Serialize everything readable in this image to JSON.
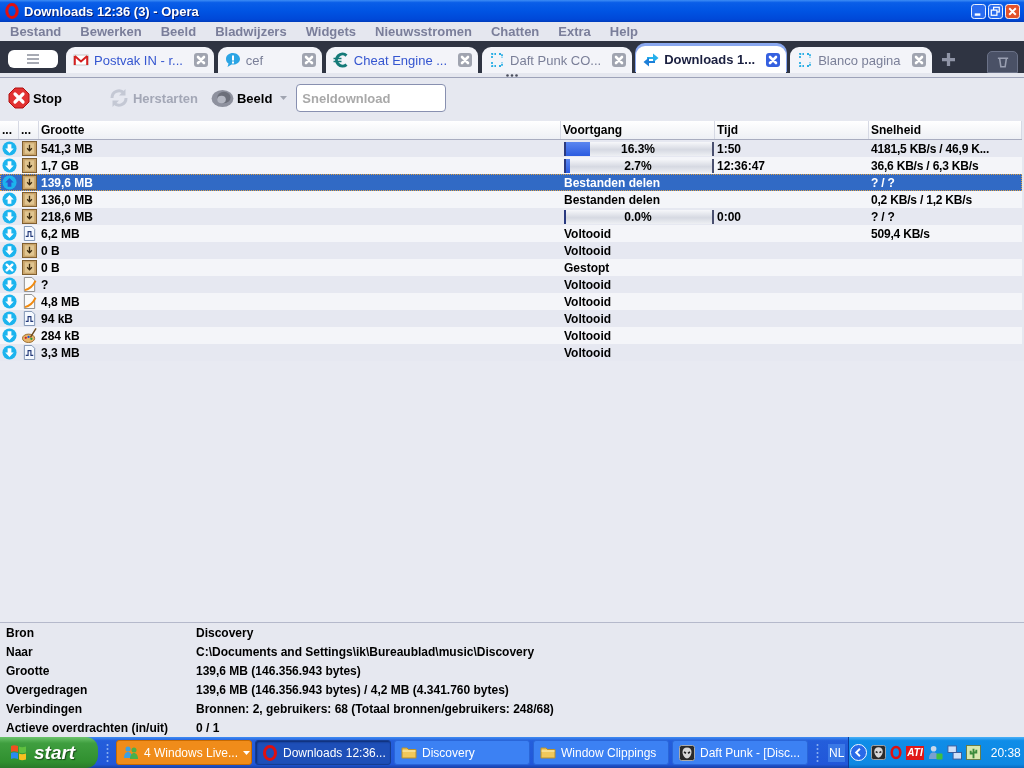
{
  "window": {
    "title": "Downloads 12:36 (3) - Opera"
  },
  "menu": [
    "Bestand",
    "Bewerken",
    "Beeld",
    "Bladwijzers",
    "Widgets",
    "Nieuwsstromen",
    "Chatten",
    "Extra",
    "Help"
  ],
  "tabs": [
    {
      "label": "Postvak IN - r...",
      "kind": "mail",
      "selected": false,
      "highlighted": true
    },
    {
      "label": "cef",
      "kind": "chat",
      "selected": false,
      "highlighted": false
    },
    {
      "label": "Cheat Engine ...",
      "kind": "app",
      "selected": false,
      "highlighted": true
    },
    {
      "label": "Daft Punk CO...",
      "kind": "page",
      "selected": false,
      "highlighted": false
    },
    {
      "label": "Downloads 1...",
      "kind": "transfers",
      "selected": true,
      "highlighted": false
    },
    {
      "label": "Blanco pagina",
      "kind": "page",
      "selected": false,
      "highlighted": false
    }
  ],
  "toolbar": {
    "buttons": [
      {
        "label": "Stop",
        "kind": "stop",
        "disabled": false
      },
      {
        "label": "Herstarten",
        "kind": "restart",
        "disabled": true
      },
      {
        "label": "Beeld",
        "kind": "view",
        "disabled": false
      }
    ],
    "search": {
      "placeholder": "Sneldownload"
    }
  },
  "table": {
    "columns": [
      "...",
      "...",
      "Grootte",
      "Voortgang",
      "Tijd",
      "Snelheid"
    ],
    "rows": [
      {
        "state": {
          "kind": "download"
        },
        "type": {
          "kind": "archive"
        },
        "size": "541,3 MB",
        "progress": {
          "kind": "bar",
          "level": 0.163,
          "label": "16.3%"
        },
        "time": "1:50",
        "speed": "4181,5 KB/s / 46,9 K...",
        "selected": false
      },
      {
        "state": {
          "kind": "download"
        },
        "type": {
          "kind": "archive"
        },
        "size": "1,7 GB",
        "progress": {
          "kind": "bar",
          "level": 0.027,
          "label": "2.7%"
        },
        "time": "12:36:47",
        "speed": "36,6 KB/s / 6,3 KB/s",
        "selected": false
      },
      {
        "state": {
          "kind": "upload"
        },
        "type": {
          "kind": "archive"
        },
        "size": "139,6 MB",
        "progress": {
          "kind": "text",
          "label": "Bestanden delen"
        },
        "speed": "? / ?",
        "selected": true
      },
      {
        "state": {
          "kind": "upload"
        },
        "type": {
          "kind": "archive"
        },
        "size": "136,0 MB",
        "progress": {
          "kind": "text",
          "label": "Bestanden delen"
        },
        "speed": "0,2 KB/s / 1,2 KB/s",
        "selected": false
      },
      {
        "state": {
          "kind": "download"
        },
        "type": {
          "kind": "archive"
        },
        "size": "218,6 MB",
        "progress": {
          "kind": "bar",
          "level": 0.0,
          "label": "0.0%"
        },
        "time": "0:00",
        "speed": "? / ?",
        "selected": false
      },
      {
        "state": {
          "kind": "download"
        },
        "type": {
          "kind": "audio"
        },
        "size": "6,2 MB",
        "progress": {
          "kind": "text",
          "label": "Voltooid"
        },
        "speed": "509,4 KB/s",
        "selected": false
      },
      {
        "state": {
          "kind": "download"
        },
        "type": {
          "kind": "archive"
        },
        "size": "0 B",
        "progress": {
          "kind": "text",
          "label": "Voltooid"
        },
        "selected": false
      },
      {
        "state": {
          "kind": "stopped"
        },
        "type": {
          "kind": "archive"
        },
        "size": "0 B",
        "progress": {
          "kind": "text",
          "label": "Gestopt"
        },
        "selected": false
      },
      {
        "state": {
          "kind": "download"
        },
        "type": {
          "kind": "document"
        },
        "size": "?",
        "progress": {
          "kind": "text",
          "label": "Voltooid"
        },
        "selected": false
      },
      {
        "state": {
          "kind": "download"
        },
        "type": {
          "kind": "document"
        },
        "size": "4,8 MB",
        "progress": {
          "kind": "text",
          "label": "Voltooid"
        },
        "selected": false
      },
      {
        "state": {
          "kind": "download"
        },
        "type": {
          "kind": "audio"
        },
        "size": "94 kB",
        "progress": {
          "kind": "text",
          "label": "Voltooid"
        },
        "selected": false
      },
      {
        "state": {
          "kind": "download"
        },
        "type": {
          "kind": "image"
        },
        "size": "284 kB",
        "progress": {
          "kind": "text",
          "label": "Voltooid"
        },
        "selected": false
      },
      {
        "state": {
          "kind": "download"
        },
        "type": {
          "kind": "audio"
        },
        "size": "3,3 MB",
        "progress": {
          "kind": "text",
          "label": "Voltooid"
        },
        "selected": false
      }
    ]
  },
  "details": [
    {
      "label": "Bron",
      "value": "Discovery"
    },
    {
      "label": "Naar",
      "value": "C:\\Documents and Settings\\ik\\Bureaublad\\music\\Discovery"
    },
    {
      "label": "Grootte",
      "value": "139,6 MB (146.356.943 bytes)"
    },
    {
      "label": "Overgedragen",
      "value": "139,6 MB (146.356.943 bytes) / 4,2 MB (4.341.760 bytes)"
    },
    {
      "label": "Verbindingen",
      "value": "Bronnen: 2, gebruikers: 68 (Totaal bronnen/gebruikers: 248/68)"
    },
    {
      "label": "Actieve overdrachten (in/uit)",
      "value": "0 / 1"
    }
  ],
  "taskbar": {
    "start": "start",
    "tasks": [
      {
        "label": "4 Windows Live...",
        "kind": "group",
        "selected": false,
        "flashing": true
      },
      {
        "label": "Downloads 12:36...",
        "kind": "browser",
        "selected": true,
        "flashing": false
      },
      {
        "label": "Discovery",
        "kind": "folder",
        "selected": false,
        "flashing": false
      },
      {
        "label": "Window Clippings",
        "kind": "folder",
        "selected": false,
        "flashing": false
      },
      {
        "label": "Daft Punk - [Disc...",
        "kind": "player",
        "selected": false,
        "flashing": false
      }
    ],
    "language": "NL",
    "tray_badge": "ATI",
    "clock": "20:38"
  }
}
